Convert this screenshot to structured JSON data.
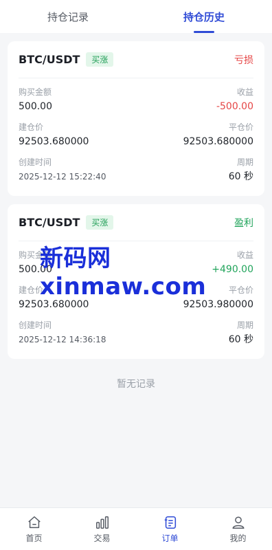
{
  "tabs": [
    {
      "label": "持仓记录",
      "active": false
    },
    {
      "label": "持仓历史",
      "active": true
    }
  ],
  "records": [
    {
      "pair": "BTC/USDT",
      "direction": "买涨",
      "result": "亏损",
      "buy_amount_label": "购买金额",
      "buy_amount": "500.00",
      "pnl_label": "收益",
      "pnl": "-500.00",
      "open_price_label": "建仓价",
      "open_price": "92503.680000",
      "close_price_label": "平仓价",
      "close_price": "92503.680000",
      "created_label": "创建时间",
      "created": "2025-12-12 15:22:40",
      "period_label": "周期",
      "period": "60 秒"
    },
    {
      "pair": "BTC/USDT",
      "direction": "买涨",
      "result": "盈利",
      "buy_amount_label": "购买金额",
      "buy_amount": "500.00",
      "pnl_label": "收益",
      "pnl": "+490.00",
      "open_price_label": "建仓价",
      "open_price": "92503.680000",
      "close_price_label": "平仓价",
      "close_price": "92503.980000",
      "created_label": "创建时间",
      "created": "2025-12-12 14:36:18",
      "period_label": "周期",
      "period": "60 秒"
    }
  ],
  "empty_text": "暂无记录",
  "watermark": "新码网xinmaw.com",
  "nav": [
    {
      "label": "首页",
      "icon": "home-icon"
    },
    {
      "label": "交易",
      "icon": "bar-chart-icon"
    },
    {
      "label": "订单",
      "icon": "order-icon",
      "active": true
    },
    {
      "label": "我的",
      "icon": "user-icon"
    }
  ],
  "colors": {
    "accent": "#2f4bd6",
    "loss": "#e54545",
    "profit": "#21a45b",
    "watermark": "#1a2fd9"
  }
}
